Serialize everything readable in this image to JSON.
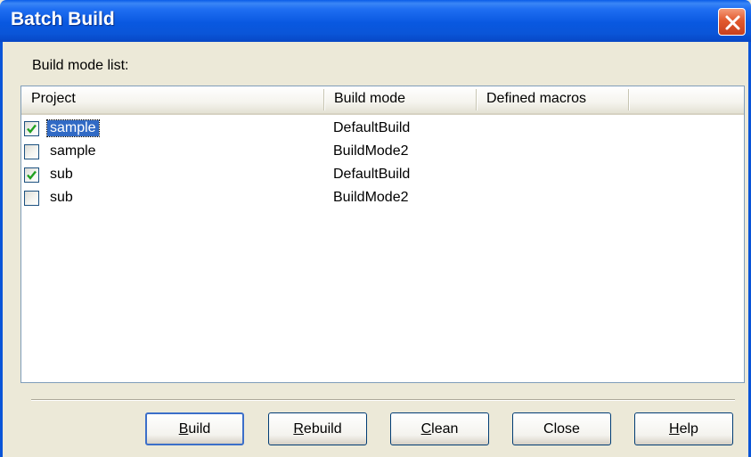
{
  "window": {
    "title": "Batch Build",
    "close_icon": "close-x-icon"
  },
  "build_mode_list_label": "Build mode list:",
  "columns": [
    "Project",
    "Build mode",
    "Defined macros"
  ],
  "rows": [
    {
      "checked": true,
      "project": "sample",
      "build_mode": "DefaultBuild",
      "defined_macros": "",
      "selected": true
    },
    {
      "checked": false,
      "project": "sample",
      "build_mode": "BuildMode2",
      "defined_macros": "",
      "selected": false
    },
    {
      "checked": true,
      "project": "sub",
      "build_mode": "DefaultBuild",
      "defined_macros": "",
      "selected": false
    },
    {
      "checked": false,
      "project": "sub",
      "build_mode": "BuildMode2",
      "defined_macros": "",
      "selected": false
    }
  ],
  "buttons": {
    "build": {
      "accel": "B",
      "rest": "uild"
    },
    "rebuild": {
      "accel": "R",
      "rest": "ebuild"
    },
    "clean": {
      "accel": "C",
      "rest": "lean"
    },
    "close": {
      "label": "Close"
    },
    "help": {
      "accel": "H",
      "rest": "elp"
    }
  },
  "colors": {
    "titlebar": "#0a55d8",
    "selection": "#316ac5",
    "close_button": "#e25a2e",
    "dialog_bg": "#ece9d8"
  }
}
